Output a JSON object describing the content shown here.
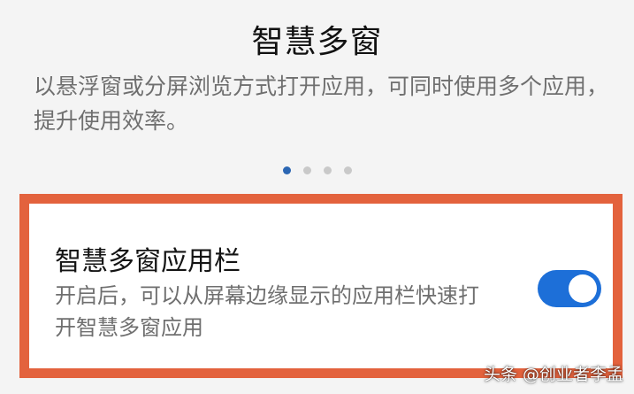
{
  "header": {
    "title": "智慧多窗",
    "description": "以悬浮窗或分屏浏览方式打开应用，可同时使用多个应用，提升使用效率。"
  },
  "pager": {
    "count": 4,
    "active_index": 0,
    "active_color": "#2b66b3",
    "inactive_color": "#c9c9c9"
  },
  "setting": {
    "title": "智慧多窗应用栏",
    "description": "开启后，可以从屏幕边缘显示的应用栏快速打开智慧多窗应用",
    "toggle_on": true,
    "toggle_color": "#1d6fd8"
  },
  "highlight_color": "#e3623d",
  "watermark": "头条 @创业者李孟"
}
